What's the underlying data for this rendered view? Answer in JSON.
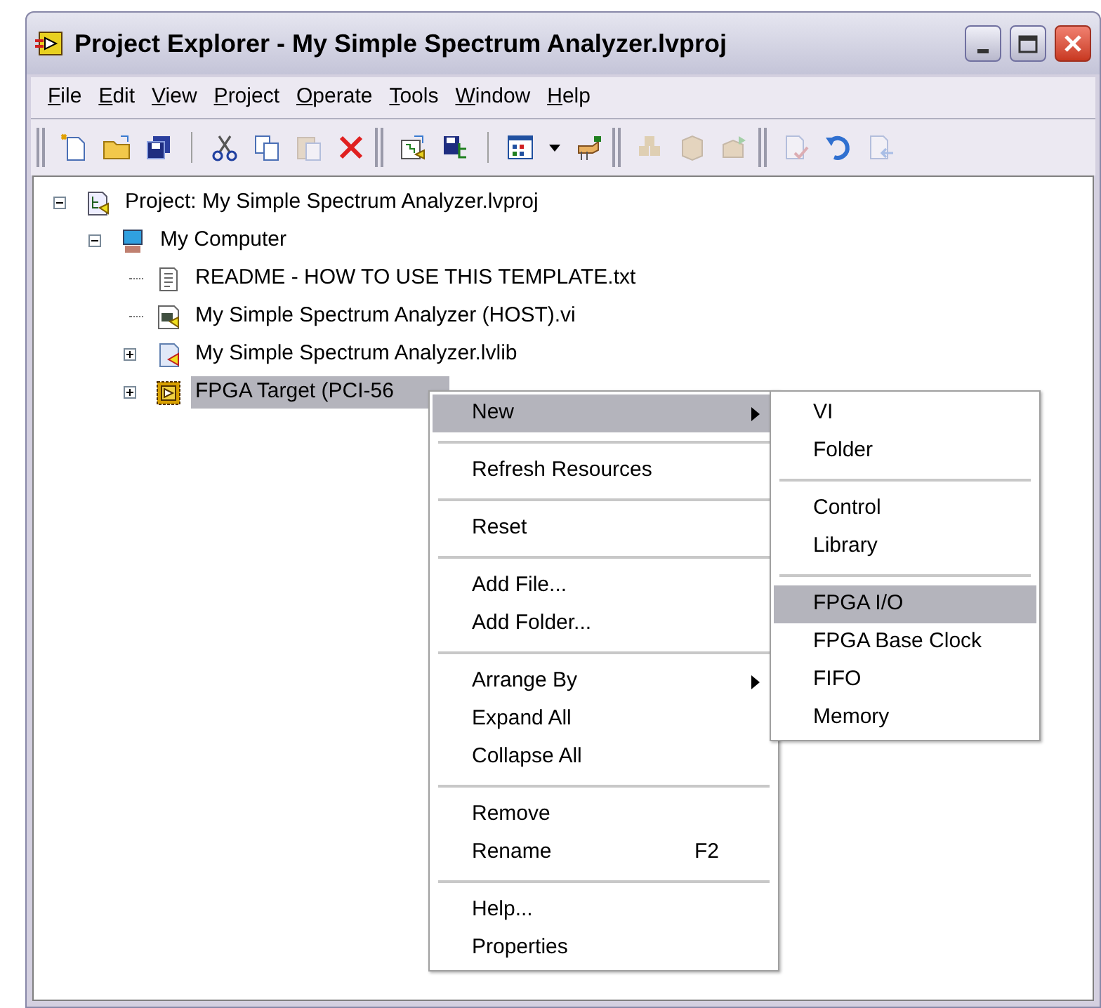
{
  "window": {
    "title": "Project Explorer - My Simple Spectrum Analyzer.lvproj"
  },
  "menu_bar": [
    {
      "label": "File"
    },
    {
      "label": "Edit"
    },
    {
      "label": "View"
    },
    {
      "label": "Project"
    },
    {
      "label": "Operate"
    },
    {
      "label": "Tools"
    },
    {
      "label": "Window"
    },
    {
      "label": "Help"
    }
  ],
  "toolbar": [
    [
      {
        "kind": "new",
        "disabled": false
      },
      {
        "kind": "open",
        "disabled": false
      },
      {
        "kind": "save-all",
        "disabled": false
      },
      {
        "kind": "sep"
      },
      {
        "kind": "cut",
        "disabled": false
      },
      {
        "kind": "copy",
        "disabled": false
      },
      {
        "kind": "paste",
        "disabled": true
      },
      {
        "kind": "delete",
        "disabled": false
      }
    ],
    [
      {
        "kind": "build",
        "disabled": false
      },
      {
        "kind": "save-build",
        "disabled": false
      },
      {
        "kind": "sep"
      },
      {
        "kind": "grid",
        "disabled": false
      },
      {
        "kind": "dropdown",
        "disabled": false
      },
      {
        "kind": "hand",
        "disabled": false
      }
    ],
    [
      {
        "kind": "boxes",
        "disabled": true
      },
      {
        "kind": "package",
        "disabled": true
      },
      {
        "kind": "deploy",
        "disabled": true
      }
    ],
    [
      {
        "kind": "check",
        "disabled": true
      },
      {
        "kind": "undo",
        "disabled": false
      },
      {
        "kind": "import",
        "disabled": true
      }
    ]
  ],
  "tree": [
    {
      "kind": "project",
      "label": "Project: My Simple Spectrum Analyzer.lvproj",
      "expanded": true,
      "selected": false,
      "children": [
        {
          "kind": "computer",
          "label": "My Computer",
          "expanded": true,
          "selected": false,
          "children": [
            {
              "kind": "text-file",
              "label": "README - HOW TO USE THIS TEMPLATE.txt",
              "selected": false
            },
            {
              "kind": "vi",
              "label": "My Simple Spectrum Analyzer (HOST).vi",
              "selected": false
            },
            {
              "kind": "library",
              "label": "My Simple Spectrum Analyzer.lvlib",
              "expanded": false,
              "selected": false
            },
            {
              "kind": "fpga",
              "label": "FPGA Target (PCI-56",
              "expanded": false,
              "selected": true
            }
          ]
        }
      ]
    }
  ],
  "context_menu": [
    [
      {
        "label": "New",
        "submenu": true,
        "selected": true
      }
    ],
    [
      {
        "label": "Refresh Resources",
        "submenu": false,
        "selected": false
      }
    ],
    [
      {
        "label": "Reset",
        "submenu": false,
        "selected": false
      }
    ],
    [
      {
        "label": "Add File...",
        "submenu": false,
        "selected": false
      },
      {
        "label": "Add Folder...",
        "submenu": false,
        "selected": false
      }
    ],
    [
      {
        "label": "Arrange By",
        "submenu": true,
        "selected": false
      },
      {
        "label": "Expand All",
        "submenu": false,
        "selected": false
      },
      {
        "label": "Collapse All",
        "submenu": false,
        "selected": false
      }
    ],
    [
      {
        "label": "Remove",
        "submenu": false,
        "selected": false
      },
      {
        "label": "Rename",
        "shortcut": "F2",
        "submenu": false,
        "selected": false
      }
    ],
    [
      {
        "label": "Help...",
        "submenu": false,
        "selected": false
      },
      {
        "label": "Properties",
        "submenu": false,
        "selected": false
      }
    ]
  ],
  "submenu": [
    [
      {
        "label": "VI",
        "selected": false
      },
      {
        "label": "Folder",
        "selected": false
      }
    ],
    [
      {
        "label": "Control",
        "selected": false
      },
      {
        "label": "Library",
        "selected": false
      }
    ],
    [
      {
        "label": "FPGA I/O",
        "selected": true
      },
      {
        "label": "FPGA Base Clock",
        "selected": false
      },
      {
        "label": "FIFO",
        "selected": false
      },
      {
        "label": "Memory",
        "selected": false
      }
    ]
  ]
}
